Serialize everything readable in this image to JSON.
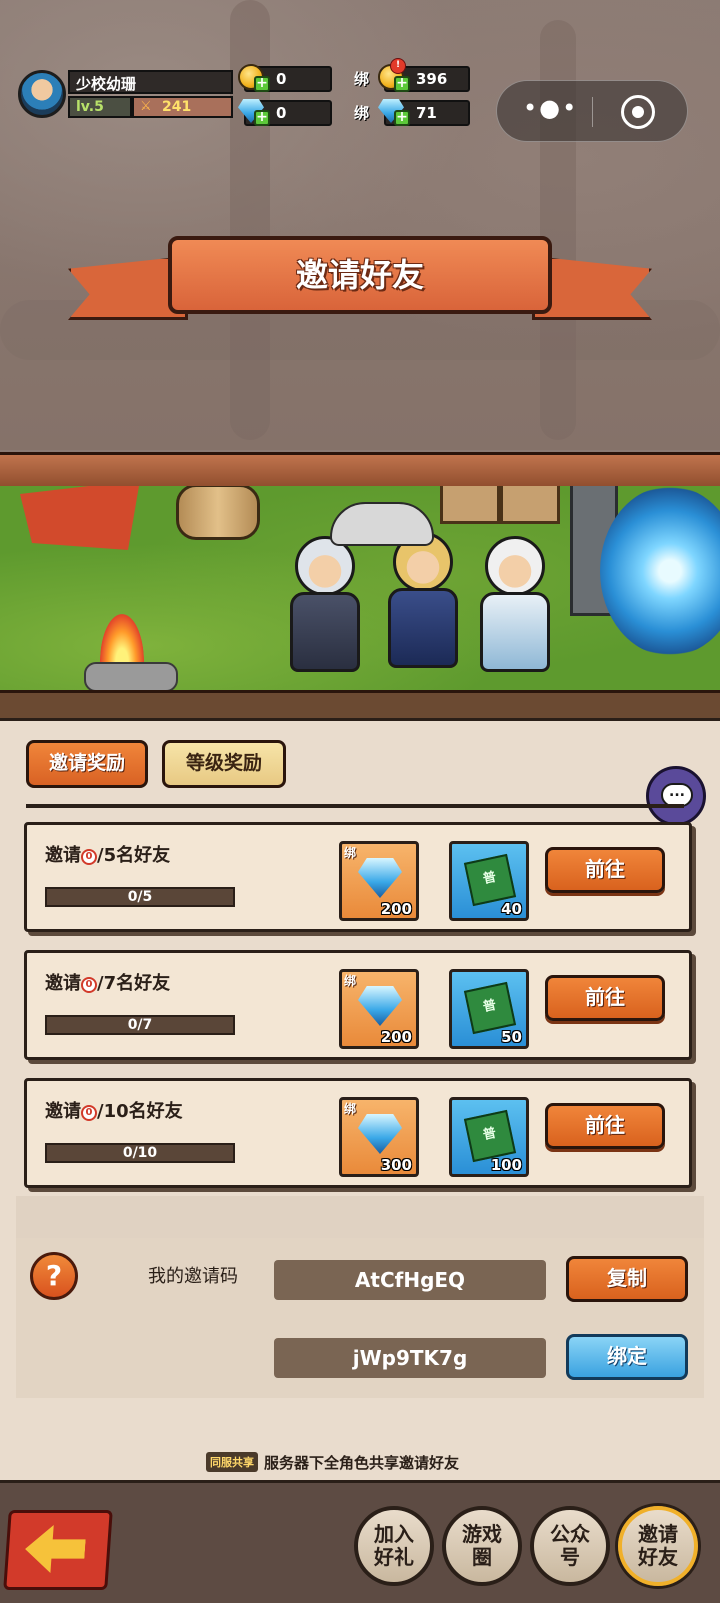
{
  "player": {
    "name": "少校幼珊",
    "level": "lv.5",
    "power": "241"
  },
  "resources": {
    "gold": "0",
    "gems": "0",
    "bind_label": "绑",
    "bound_gold": "396",
    "bound_gold_badge": "!",
    "bound_gems": "71"
  },
  "capsule": {
    "more_icon": "more-dots-icon",
    "close_icon": "target-close-icon"
  },
  "title": "邀请好友",
  "tabs": [
    {
      "label": "邀请奖励",
      "active": true
    },
    {
      "label": "等级奖励",
      "active": false
    }
  ],
  "tasks": [
    {
      "prefix": "邀请",
      "current": "0",
      "suffix": "/5名好友",
      "progress_text": "0/5",
      "progress": 0.0,
      "reward_gem_tag": "绑",
      "reward_gem_qty": "200",
      "reward_ticket_tag": "普",
      "reward_ticket_qty": "40",
      "button": "前往"
    },
    {
      "prefix": "邀请",
      "current": "0",
      "suffix": "/7名好友",
      "progress_text": "0/7",
      "progress": 0.0,
      "reward_gem_tag": "绑",
      "reward_gem_qty": "200",
      "reward_ticket_tag": "普",
      "reward_ticket_qty": "50",
      "button": "前往"
    },
    {
      "prefix": "邀请",
      "current": "0",
      "suffix": "/10名好友",
      "progress_text": "0/10",
      "progress": 0.0,
      "reward_gem_tag": "绑",
      "reward_gem_qty": "300",
      "reward_ticket_tag": "普",
      "reward_ticket_qty": "100",
      "button": "前往"
    }
  ],
  "invite": {
    "help": "?",
    "label": "我的邀请码",
    "my_code": "AtCfHgEQ",
    "copy_button": "复制",
    "input_code": "jWp9TK7g",
    "bind_button": "绑定"
  },
  "note": {
    "badge": "同服共享",
    "text": "服务器下全角色共享邀请好友"
  },
  "chat_icon": "...",
  "bottom_nav": [
    {
      "label": "加入好礼",
      "highlighted": false
    },
    {
      "label": "游戏圈",
      "highlighted": false
    },
    {
      "label": "公众号",
      "highlighted": false
    },
    {
      "label": "邀请好友",
      "highlighted": true
    }
  ],
  "colors": {
    "accent_orange": "#e0702c",
    "accent_blue": "#3aa2e0",
    "panel": "#e9dccd"
  }
}
